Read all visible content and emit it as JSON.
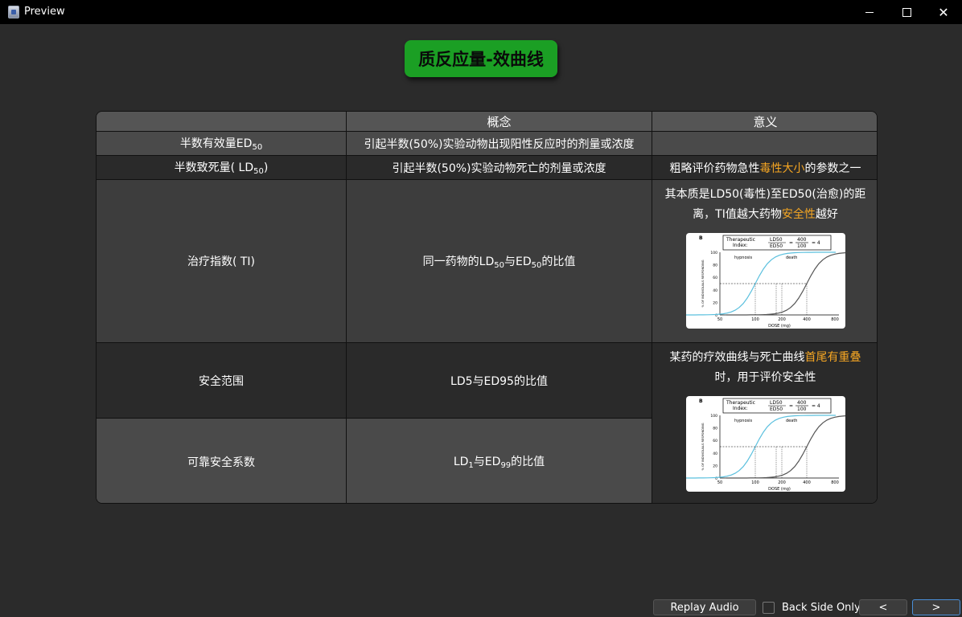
{
  "window": {
    "title": "Preview",
    "minimize": "",
    "maximize": "",
    "close": "✕"
  },
  "page_title": "质反应量-效曲线",
  "table": {
    "headers": [
      "",
      "概念",
      "意义"
    ],
    "rows": [
      {
        "name_pre": "半数有效量ED",
        "name_sub": "50",
        "name_post": "",
        "concept_pre": "引起半数(50%)实验动物出现阳性反应时的剂量或浓度",
        "meaning": ""
      },
      {
        "name_pre": "半数致死量( LD",
        "name_sub": "50",
        "name_post": ")",
        "concept_pre": "引起半数(50%)实验动物死亡的剂量或浓度",
        "meaning_pre": "粗略评价药物急性",
        "meaning_hl": "毒性大小",
        "meaning_post": "的参数之一"
      },
      {
        "name_pre": "治疗指数( TI)",
        "concept_pre": "同一药物的LD",
        "concept_sub1": "50",
        "concept_mid": "与ED",
        "concept_sub2": "50",
        "concept_post": "的比值",
        "meaning_pre": "其本质是LD50(毒性)至ED50(治愈)的距离，TI值越大药物",
        "meaning_hl": "安全性",
        "meaning_post": "越好"
      },
      {
        "name_pre": "安全范围",
        "concept_pre": "LD5与ED95的比值",
        "meaning_pre": "某药的疗效曲线与死亡曲线",
        "meaning_hl": "首尾有重叠",
        "meaning_post": "时，用于评价安全性"
      },
      {
        "name_pre": "可靠安全系数",
        "concept_pre": "LD",
        "concept_sub1": "1",
        "concept_mid": "与ED",
        "concept_sub2": "99",
        "concept_post": "的比值"
      }
    ]
  },
  "figure": {
    "panel_label": "B",
    "index_label_1": "Therapeutic",
    "index_label_2": "Index:",
    "frac_top": "LD",
    "frac_top_sub": "50",
    "frac_bottom": "ED",
    "frac_bottom_sub": "50",
    "equals": "=",
    "num_top": "400",
    "num_bottom": "100",
    "result": "= 4",
    "curve_left_label": "hypnosis",
    "curve_right_label": "death",
    "y_axis_label": "% OF INDIVIDUALS RESPONDING",
    "x_axis_label": "DOSE (mg)",
    "y_ticks": [
      "100",
      "80",
      "60",
      "40",
      "20",
      "0"
    ],
    "x_ticks": [
      "50",
      "100",
      "200",
      "400",
      "800"
    ],
    "colors": {
      "hypnosis": "#5bc0de",
      "death": "#555555"
    }
  },
  "bottom": {
    "replay": "Replay Audio",
    "back_side_only": "Back Side Only",
    "prev": "<",
    "next": ">"
  },
  "colors": {
    "title_bg": "#1b9f24",
    "highlight": "#f5a623",
    "header_bg": "#555555"
  }
}
